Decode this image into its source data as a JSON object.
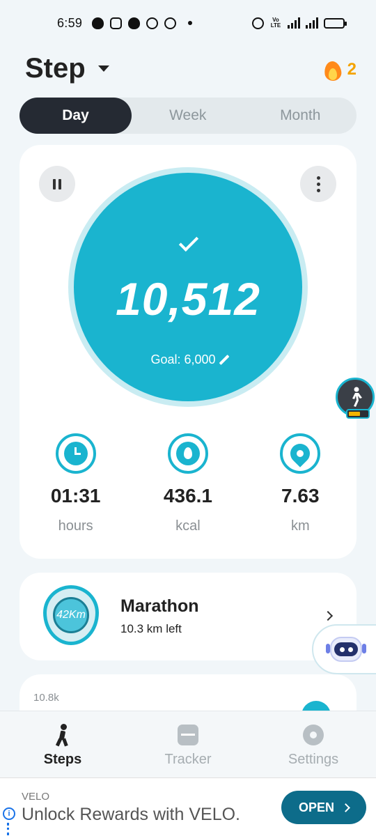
{
  "status_bar": {
    "time": "6:59",
    "volte_label": "Vo LTE",
    "icons": [
      "snapchat-icon",
      "instagram-icon",
      "messenger-icon",
      "whatsapp-icon",
      "whatsapp-icon",
      "alarm-icon",
      "signal-icon",
      "battery-icon"
    ]
  },
  "header": {
    "title": "Step",
    "streak_count": "2"
  },
  "period_tabs": [
    {
      "label": "Day",
      "active": true
    },
    {
      "label": "Week",
      "active": false
    },
    {
      "label": "Month",
      "active": false
    }
  ],
  "progress": {
    "steps": "10,512",
    "goal_label": "Goal: 6,000",
    "goal_met": true
  },
  "stats": [
    {
      "value": "01:31",
      "unit": "hours",
      "icon": "clock-icon"
    },
    {
      "value": "436.1",
      "unit": "kcal",
      "icon": "flame-icon"
    },
    {
      "value": "7.63",
      "unit": "km",
      "icon": "location-pin-icon"
    }
  ],
  "marathon": {
    "badge_text": "42Km",
    "title": "Marathon",
    "subtitle": "10.3 km left"
  },
  "chart_preview": {
    "y_max_label": "10.8k"
  },
  "bottom_nav": [
    {
      "label": "Steps",
      "active": true
    },
    {
      "label": "Tracker",
      "active": false
    },
    {
      "label": "Settings",
      "active": false
    }
  ],
  "ad": {
    "brand": "VELO",
    "headline": "Unlock Rewards with VELO.",
    "button_label": "OPEN"
  },
  "colors": {
    "accent": "#1ab4cf",
    "dark": "#252a33",
    "streak": "#f4a300",
    "background": "#f1f6f9",
    "ad_button": "#0d6c8a"
  }
}
